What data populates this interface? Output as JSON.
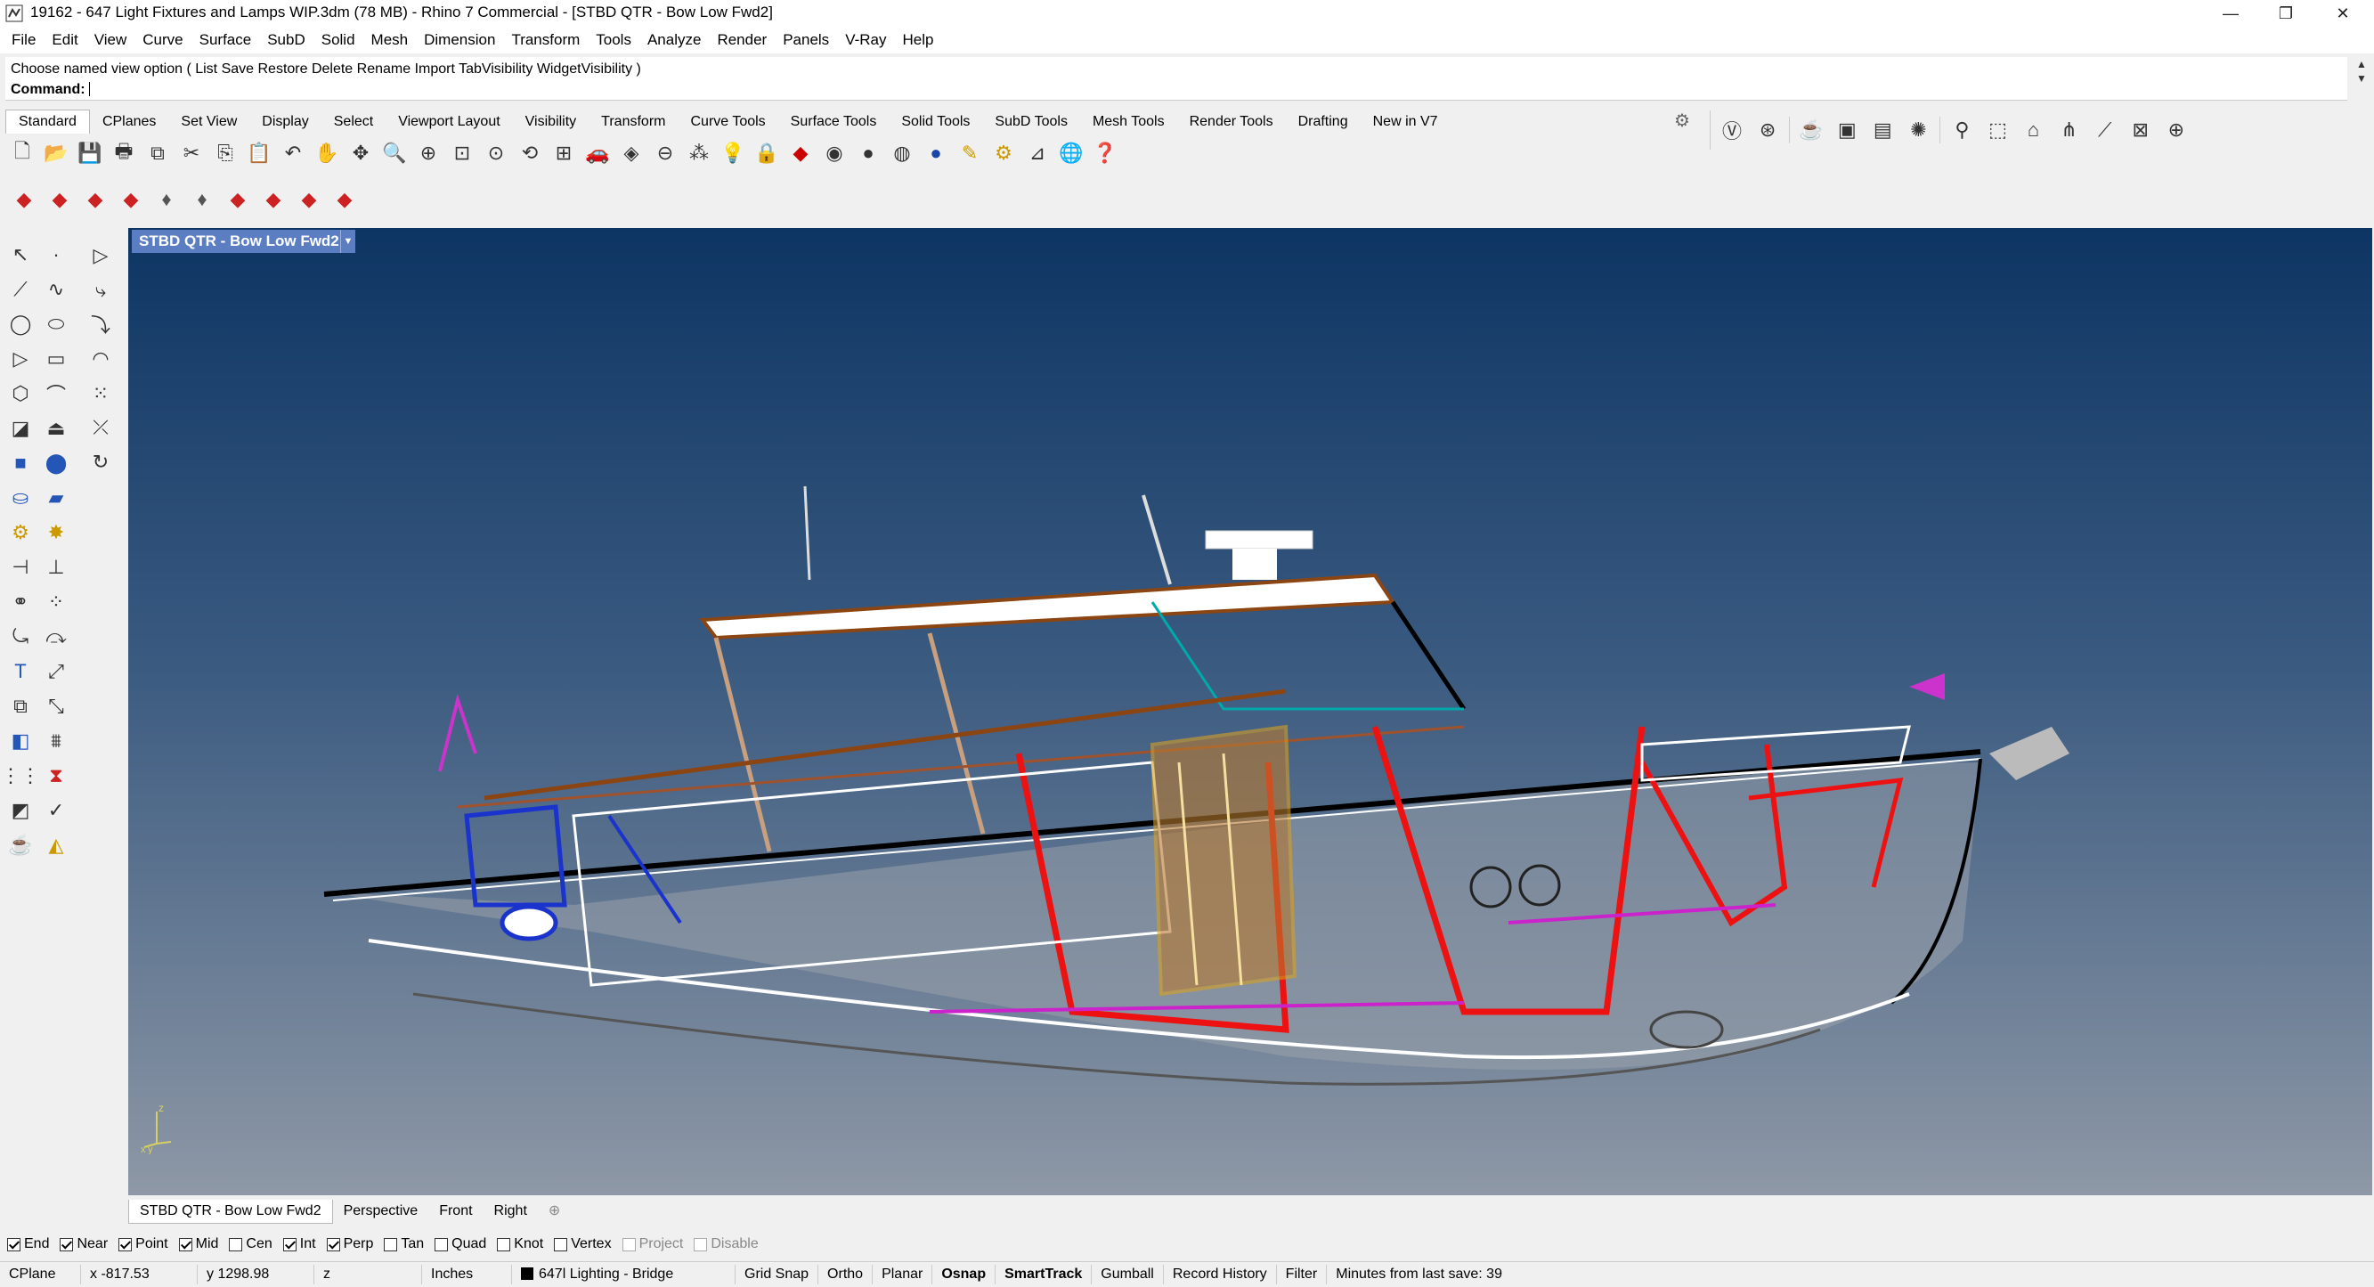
{
  "window": {
    "title": "19162 - 647 Light Fixtures and Lamps WIP.3dm (78 MB) - Rhino 7 Commercial - [STBD QTR - Bow Low Fwd2]",
    "min_glyph": "—",
    "max_glyph": "❐",
    "close_glyph": "✕"
  },
  "menu": [
    "File",
    "Edit",
    "View",
    "Curve",
    "Surface",
    "SubD",
    "Solid",
    "Mesh",
    "Dimension",
    "Transform",
    "Tools",
    "Analyze",
    "Render",
    "Panels",
    "V-Ray",
    "Help"
  ],
  "command": {
    "history": "Choose named view option ( List  Save  Restore  Delete  Rename  Import  TabVisibility  WidgetVisibility )",
    "prompt": "Command:"
  },
  "toolbar_tabs": [
    "Standard",
    "CPlanes",
    "Set View",
    "Display",
    "Select",
    "Viewport Layout",
    "Visibility",
    "Transform",
    "Curve Tools",
    "Surface Tools",
    "Solid Tools",
    "SubD Tools",
    "Mesh Tools",
    "Render Tools",
    "Drafting",
    "New in V7"
  ],
  "viewport": {
    "title": "STBD QTR - Bow Low Fwd2",
    "axis_z": "z",
    "axis_x": "x",
    "axis_y": "y"
  },
  "viewport_tabs": [
    "STBD QTR - Bow Low Fwd2",
    "Perspective",
    "Front",
    "Right"
  ],
  "osnaps": [
    {
      "label": "End",
      "checked": true,
      "disabled": false
    },
    {
      "label": "Near",
      "checked": true,
      "disabled": false
    },
    {
      "label": "Point",
      "checked": true,
      "disabled": false
    },
    {
      "label": "Mid",
      "checked": true,
      "disabled": false
    },
    {
      "label": "Cen",
      "checked": false,
      "disabled": false
    },
    {
      "label": "Int",
      "checked": true,
      "disabled": false
    },
    {
      "label": "Perp",
      "checked": true,
      "disabled": false
    },
    {
      "label": "Tan",
      "checked": false,
      "disabled": false
    },
    {
      "label": "Quad",
      "checked": false,
      "disabled": false
    },
    {
      "label": "Knot",
      "checked": false,
      "disabled": false
    },
    {
      "label": "Vertex",
      "checked": false,
      "disabled": false
    },
    {
      "label": "Project",
      "checked": false,
      "disabled": true
    },
    {
      "label": "Disable",
      "checked": false,
      "disabled": true
    }
  ],
  "status": {
    "cplane": "CPlane",
    "x": "x -817.53",
    "y": "y 1298.98",
    "z": "z",
    "units": "Inches",
    "layer": "647l Lighting - Bridge",
    "grid_snap": "Grid Snap",
    "ortho": "Ortho",
    "planar": "Planar",
    "osnap": "Osnap",
    "smarttrack": "SmartTrack",
    "gumball": "Gumball",
    "record_history": "Record History",
    "filter": "Filter",
    "save_info": "Minutes from last save: 39"
  }
}
